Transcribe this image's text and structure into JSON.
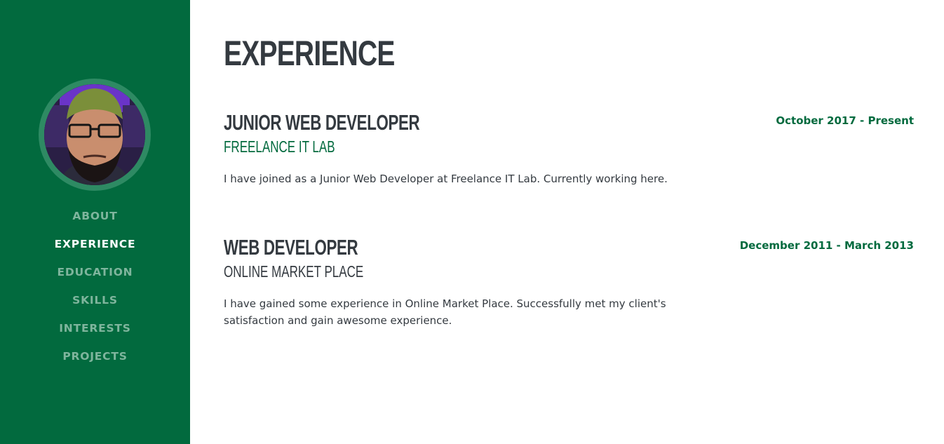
{
  "colors": {
    "sidebar_bg": "#026a3e",
    "avatar_ring": "#2e8a63",
    "nav_inactive": "#7fb59d",
    "nav_active": "#ffffff",
    "heading": "#343a40",
    "accent_green": "#026a3e"
  },
  "sidebar": {
    "avatar_alt": "profile photo",
    "nav": [
      {
        "label": "About",
        "active": false
      },
      {
        "label": "Experience",
        "active": true
      },
      {
        "label": "Education",
        "active": false
      },
      {
        "label": "Skills",
        "active": false
      },
      {
        "label": "Interests",
        "active": false
      },
      {
        "label": "Projects",
        "active": false
      }
    ]
  },
  "main": {
    "title": "Experience",
    "entries": [
      {
        "title": "Junior Web Developer",
        "company": "Freelance IT Lab",
        "company_color": "#026a3e",
        "date": "October 2017 - Present",
        "description": "I have joined as a Junior Web Developer at Freelance IT Lab. Currently working here."
      },
      {
        "title": "Web Developer",
        "company": "Online Market Place",
        "company_color": "#343a40",
        "date": "December 2011 - March 2013",
        "description": "I have gained some experience in Online Market Place. Successfully met my client's satisfaction and gain awesome experience."
      }
    ]
  }
}
